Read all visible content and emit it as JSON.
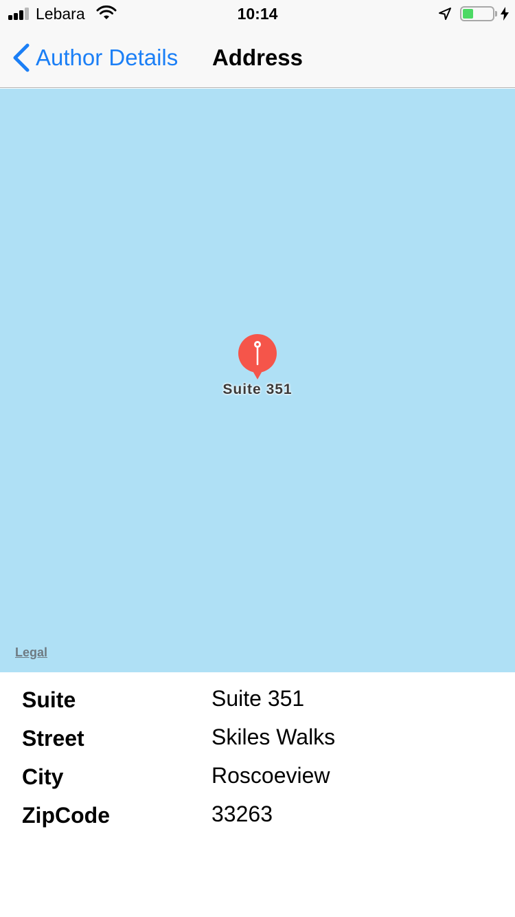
{
  "status_bar": {
    "carrier": "Lebara",
    "time": "10:14",
    "signal_bars_filled": 3,
    "signal_bars_total": 4,
    "battery_level": 0.35,
    "battery_color": "#4cd964",
    "icons": [
      "signal-icon",
      "wifi-icon",
      "location-arrow-icon",
      "battery-icon",
      "charging-bolt-icon"
    ]
  },
  "nav": {
    "back_label": "Author Details",
    "title": "Address",
    "accent_color": "#1b7ff6"
  },
  "map": {
    "background_color": "#afe0f5",
    "pin_label": "Suite 351",
    "pin_color": "#f5554a",
    "legal_label": "Legal"
  },
  "details": {
    "rows": [
      {
        "label": "Suite",
        "value": "Suite 351"
      },
      {
        "label": "Street",
        "value": "Skiles Walks"
      },
      {
        "label": "City",
        "value": "Roscoeview"
      },
      {
        "label": "ZipCode",
        "value": "33263"
      }
    ]
  }
}
